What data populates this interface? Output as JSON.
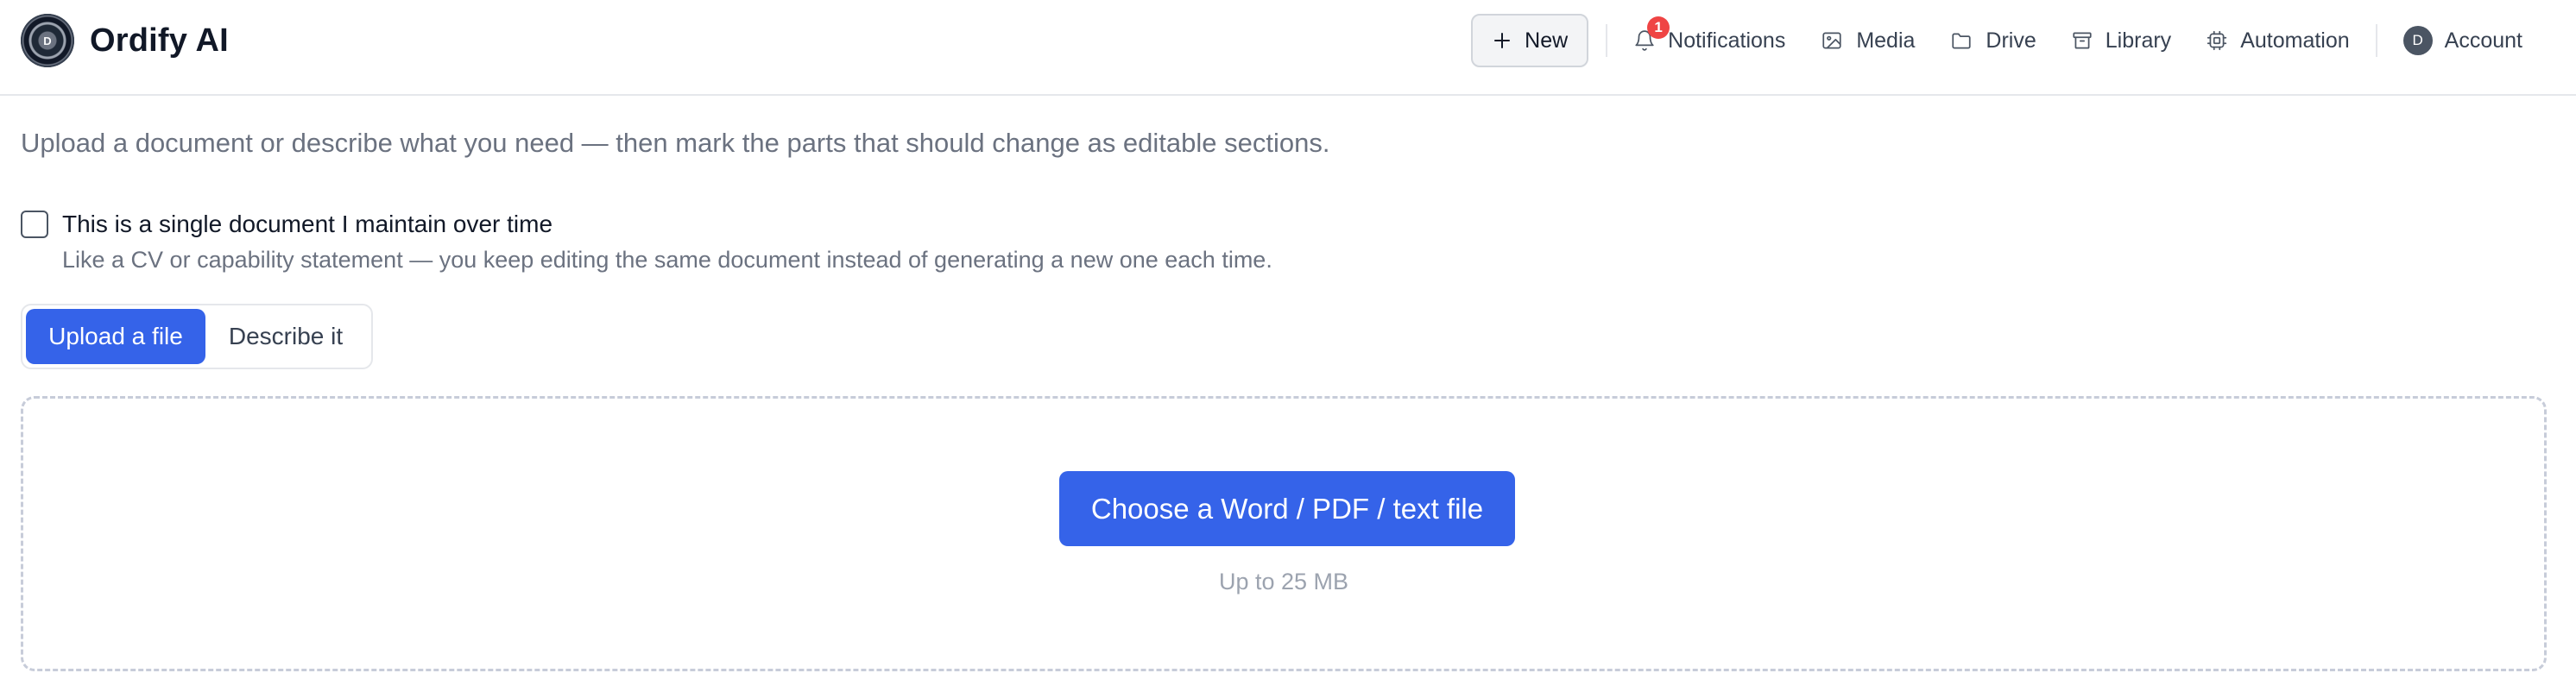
{
  "app": {
    "logo_letter": "D",
    "name": "Ordify AI"
  },
  "nav": {
    "new_label": "New",
    "notifications_label": "Notifications",
    "notifications_count": "1",
    "media_label": "Media",
    "drive_label": "Drive",
    "library_label": "Library",
    "automation_label": "Automation",
    "account_initial": "D",
    "account_label": "Account"
  },
  "main": {
    "intro": "Upload a document or describe what you need — then mark the parts that should change as editable sections.",
    "single_doc": {
      "checked": false,
      "label": "This is a single document I maintain over time",
      "help": "Like a CV or capability statement — you keep editing the same document instead of generating a new one each time."
    },
    "mode_tabs": {
      "upload_label": "Upload a file",
      "describe_label": "Describe it",
      "selected": "Upload a file"
    },
    "dropzone": {
      "button_label": "Choose a Word / PDF / text file",
      "limit_text": "Up to 25 MB"
    }
  },
  "colors": {
    "accent": "#3563e9",
    "badge": "#ef4444",
    "muted_text": "#6b7280"
  },
  "icons": [
    "plus-icon",
    "bell-icon",
    "image-icon",
    "folder-icon",
    "archive-icon",
    "cpu-icon"
  ]
}
